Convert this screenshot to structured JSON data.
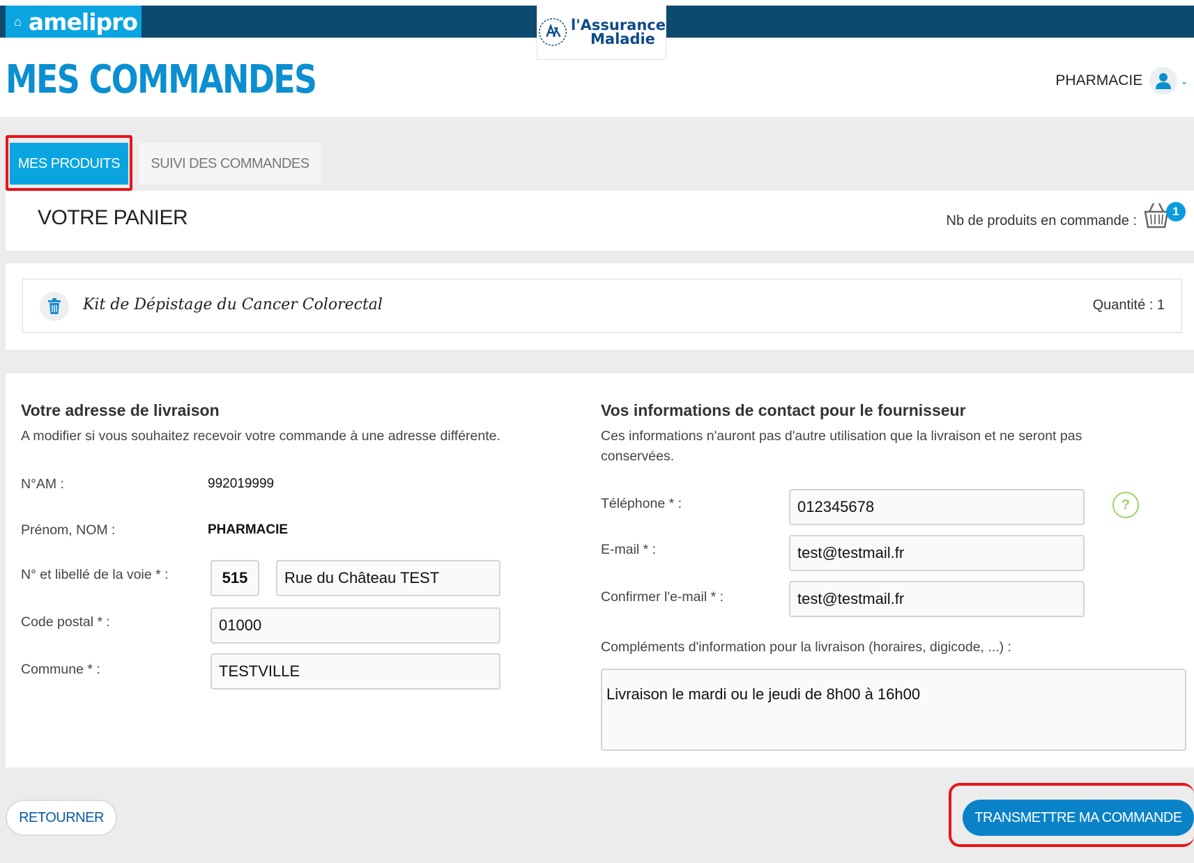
{
  "header": {
    "brand": "amelipro",
    "logo_line1": "l'Assurance",
    "logo_line2": "Maladie",
    "page_title": "MES COMMANDES",
    "user_label": "PHARMACIE"
  },
  "tabs": [
    {
      "label": "MES PRODUITS",
      "active": true
    },
    {
      "label": "SUIVI DES COMMANDES",
      "active": false
    }
  ],
  "cart": {
    "title": "VOTRE PANIER",
    "count_label": "Nb de produits en commande :",
    "count": "1"
  },
  "product": {
    "name": "Kit de Dépistage du Cancer Colorectal",
    "quantity_label": "Quantité : 1"
  },
  "delivery": {
    "title": "Votre adresse de livraison",
    "description": "A modifier si vous souhaitez recevoir votre commande à une adresse différente.",
    "nam_label": "N°AM :",
    "nam_value": "992019999",
    "name_label": "Prénom, NOM :",
    "name_value": "PHARMACIE",
    "street_label": "N° et libellé de la voie * :",
    "street_number": "515",
    "street_name": "Rue du Château TEST",
    "postal_label": "Code postal * :",
    "postal_value": "01000",
    "city_label": "Commune * :",
    "city_value": "TESTVILLE"
  },
  "contact": {
    "title": "Vos informations de contact pour le fournisseur",
    "description": "Ces informations n'auront pas d'autre utilisation que la livraison et ne seront pas conservées.",
    "phone_label": "Téléphone * :",
    "phone_value": "012345678",
    "help_icon": "?",
    "email_label": "E-mail * :",
    "email_value": "test@testmail.fr",
    "confirm_label": "Confirmer l'e-mail * :",
    "confirm_value": "test@testmail.fr",
    "info_label": "Compléments d'information pour la livraison (horaires, digicode, ...) :",
    "info_value": "Livraison le mardi ou le jeudi de 8h00 à 16h00"
  },
  "actions": {
    "back_label": "RETOURNER",
    "submit_label": "TRANSMETTRE MA COMMANDE"
  },
  "colors": {
    "brand_blue": "#0aa5e0",
    "dark_navy": "#0c4a6e",
    "highlight_red": "#e8141a",
    "help_green": "#9dd36a"
  }
}
